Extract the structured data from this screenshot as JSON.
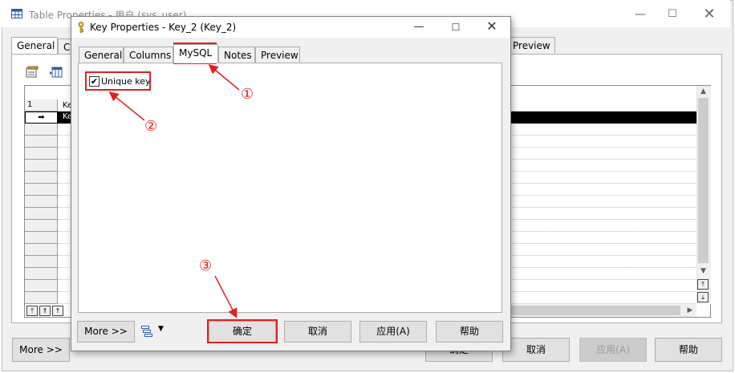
{
  "back_window": {
    "title": "Table Properties - 用户 (sys_user)",
    "controls": {
      "minimize": "—",
      "maximize": "☐",
      "close": "✕"
    },
    "tabs": [
      "General",
      "C",
      "Preview"
    ],
    "grid_rows": [
      "1",
      "➡"
    ],
    "grid_cells": [
      "Ke",
      "Ke"
    ],
    "scroll": {
      "up": "▲",
      "down": "▼",
      "right": "▶",
      "top": "⤒",
      "bottom": "⤓"
    },
    "nav_buttons": [
      "⤒",
      "⇑",
      "↑"
    ],
    "buttons": {
      "more": "More >>",
      "ok": "确定",
      "cancel": "取消",
      "apply": "应用(A)",
      "help": "帮助"
    }
  },
  "dialog": {
    "title": "Key Properties - Key_2 (Key_2)",
    "controls": {
      "minimize": "—",
      "maximize": "☐",
      "close": "✕"
    },
    "tabs": [
      "General",
      "Columns",
      "MySQL",
      "Notes",
      "Preview"
    ],
    "active_tab": "MySQL",
    "checkbox": {
      "label": "Unique key",
      "checked": true,
      "mark": "✔"
    },
    "buttons": {
      "more": "More >>",
      "ok": "确定",
      "cancel": "取消",
      "apply": "应用(A)",
      "help": "帮助"
    },
    "dropdown_arrow": "▼"
  },
  "annotations": [
    "①",
    "②",
    "③"
  ],
  "colors": {
    "annotation": "#e02020",
    "selected_row": "#000000",
    "window_bg": "#f0f0f0"
  }
}
